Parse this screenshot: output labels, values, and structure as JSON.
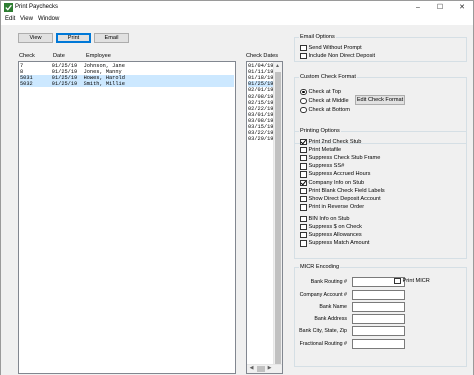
{
  "window": {
    "title": "Print Paychecks",
    "minimize_glyph": "–",
    "maximize_glyph": "☐",
    "close_glyph": "✕",
    "accent": "#0078d7"
  },
  "menu": [
    "Edit",
    "View",
    "Window"
  ],
  "toolbar": {
    "view_label": "View",
    "print_label": "Print",
    "email_label": "Email"
  },
  "checks_list": {
    "headers": {
      "check": "Check",
      "date": "Date",
      "employee": "Employee"
    },
    "rows": [
      {
        "text": "7         01/25/19  Johnson, Jane",
        "selected": false
      },
      {
        "text": "8         01/25/19  Jones, Manny",
        "selected": false
      },
      {
        "text": "5031      01/25/19  Howes, Harold",
        "selected": true
      },
      {
        "text": "5032      01/25/19  Smith, Millie",
        "selected": true
      }
    ]
  },
  "check_dates": {
    "header": "Check Dates",
    "rows": [
      {
        "text": "01/04/19",
        "selected": false
      },
      {
        "text": "01/11/19",
        "selected": false
      },
      {
        "text": "01/18/19",
        "selected": false
      },
      {
        "text": "01/25/19",
        "selected": true
      },
      {
        "text": "02/01/19",
        "selected": false
      },
      {
        "text": "02/08/19",
        "selected": false
      },
      {
        "text": "02/15/19",
        "selected": false
      },
      {
        "text": "02/22/19",
        "selected": false
      },
      {
        "text": "03/01/19",
        "selected": false
      },
      {
        "text": "03/08/19",
        "selected": false
      },
      {
        "text": "03/15/19",
        "selected": false
      },
      {
        "text": "03/22/19",
        "selected": false
      },
      {
        "text": "03/29/19",
        "selected": false
      }
    ]
  },
  "email_options": {
    "title": "Email Options",
    "items": [
      {
        "label": "Send Without Prompt",
        "checked": false
      },
      {
        "label": "Include Non Direct Deposit",
        "checked": false
      }
    ]
  },
  "custom_format": {
    "title": "Custom Check Format",
    "radios": [
      {
        "label": "Check at Top",
        "checked": true
      },
      {
        "label": "Check at Middle",
        "checked": false
      },
      {
        "label": "Check at Bottom",
        "checked": false
      }
    ],
    "edit_button": "Edit Check Format"
  },
  "printing_options": {
    "title": "Printing Options",
    "items": [
      {
        "label": "Print 2nd Check Stub",
        "checked": true
      },
      {
        "label": "Print Metafile",
        "checked": false
      },
      {
        "label": "Suppress Check Stub Frame",
        "checked": false
      },
      {
        "label": "Suppress SS#",
        "checked": false
      },
      {
        "label": "Suppress Accrued Hours",
        "checked": false
      },
      {
        "label": "Company Info on Stub",
        "checked": true
      },
      {
        "label": "Print Blank Check Field Labels",
        "checked": false
      },
      {
        "label": "Show Direct Deposit Account",
        "checked": false
      },
      {
        "label": "Print in Reverse Order",
        "checked": false
      }
    ],
    "items2": [
      {
        "label": "BIN Info on Stub",
        "checked": false
      },
      {
        "label": "Suppress $ on Check",
        "checked": false
      },
      {
        "label": "Suppress Allowances",
        "checked": false
      },
      {
        "label": "Suppress Match Amount",
        "checked": false
      }
    ]
  },
  "micr": {
    "title": "MICR Encoding",
    "fields": [
      {
        "label": "Bank Routing #",
        "value": ""
      },
      {
        "label": "Company Account #",
        "value": ""
      },
      {
        "label": "Bank Name",
        "value": ""
      },
      {
        "label": "Bank Address",
        "value": ""
      },
      {
        "label": "Bank City, State, Zip",
        "value": ""
      },
      {
        "label": "Fractional Routing #",
        "value": ""
      }
    ],
    "print_micr": {
      "label": "Print MICR",
      "checked": false
    }
  }
}
